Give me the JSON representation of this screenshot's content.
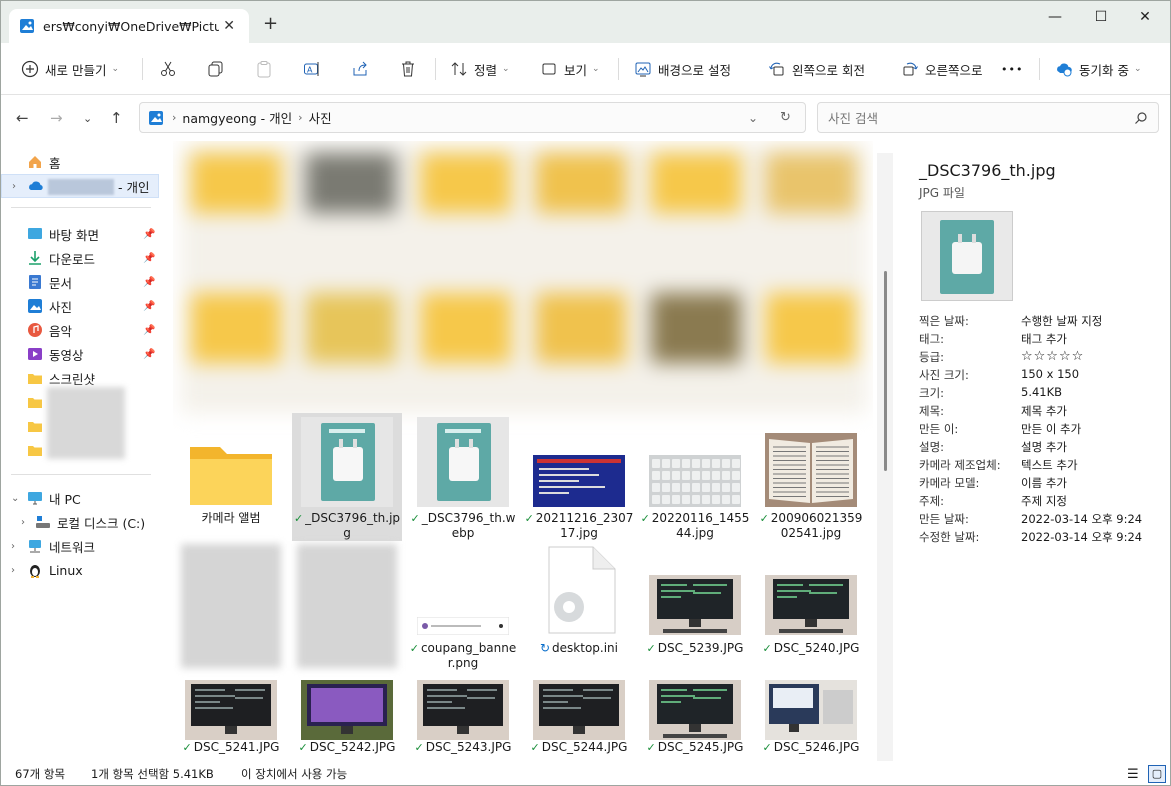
{
  "titlebar": {
    "tab_title": "ers₩conyi₩OneDrive₩Pictures",
    "close_tab": "✕",
    "new_tab": "+",
    "minimize": "—",
    "maximize": "☐",
    "close": "✕"
  },
  "toolbar": {
    "new": "새로 만들기",
    "sort": "정렬",
    "view": "보기",
    "set_background": "배경으로 설정",
    "rotate_left": "왼쪽으로 회전",
    "rotate_right": "오른쪽으로",
    "more": "•••",
    "sync": "동기화 중"
  },
  "address": {
    "path": [
      "namgyeong - 개인",
      "사진"
    ],
    "search_placeholder": "사진 검색"
  },
  "sidebar": {
    "home": "홈",
    "onedrive": "- 개인",
    "quick": [
      {
        "label": "바탕 화면",
        "icon": "desktop-icon",
        "pinned": true
      },
      {
        "label": "다운로드",
        "icon": "download-icon",
        "pinned": true
      },
      {
        "label": "문서",
        "icon": "document-icon",
        "pinned": true
      },
      {
        "label": "사진",
        "icon": "pictures-icon",
        "pinned": true
      },
      {
        "label": "음악",
        "icon": "music-icon",
        "pinned": true
      },
      {
        "label": "동영상",
        "icon": "video-icon",
        "pinned": true
      },
      {
        "label": "스크린샷",
        "icon": "folder-icon",
        "pinned": false
      }
    ],
    "pc": "내 PC",
    "drive": "로컬 디스크 (C:)",
    "network": "네트워크",
    "linux": "Linux"
  },
  "files": [
    {
      "name": "카메라 앨범",
      "kind": "folder",
      "synced": false
    },
    {
      "name": "_DSC3796_th.jpg",
      "kind": "product",
      "synced": true,
      "selected": true
    },
    {
      "name": "_DSC3796_th.webp",
      "kind": "product",
      "synced": true
    },
    {
      "name": "20211216_230717.jpg",
      "kind": "screen-blue",
      "synced": true
    },
    {
      "name": "20220116_145544.jpg",
      "kind": "keyboard",
      "synced": true
    },
    {
      "name": "20090602135902541.jpg",
      "kind": "book",
      "synced": true
    },
    {
      "name": "coupang_banner.png",
      "kind": "banner",
      "synced": true
    },
    {
      "name": "desktop.ini",
      "kind": "ini",
      "synced": false,
      "syncing": true
    },
    {
      "name": "DSC_5239.JPG",
      "kind": "monitor",
      "synced": true
    },
    {
      "name": "DSC_5240.JPG",
      "kind": "monitor",
      "synced": true
    },
    {
      "name": "DSC_5241.JPG",
      "kind": "monitor-dark",
      "synced": true
    },
    {
      "name": "DSC_5242.JPG",
      "kind": "monitor-purple",
      "synced": true
    },
    {
      "name": "DSC_5243.JPG",
      "kind": "monitor-dark",
      "synced": true
    },
    {
      "name": "DSC_5244.JPG",
      "kind": "monitor-dark",
      "synced": true
    },
    {
      "name": "DSC_5245.JPG",
      "kind": "monitor",
      "synced": true
    },
    {
      "name": "DSC_5246.JPG",
      "kind": "monitor-light",
      "synced": true
    }
  ],
  "details": {
    "title": "_DSC3796_th.jpg",
    "type": "JPG 파일",
    "props": [
      {
        "k": "찍은 날짜:",
        "v": "수행한 날짜 지정"
      },
      {
        "k": "태그:",
        "v": "태그 추가"
      },
      {
        "k": "등급:",
        "v": "☆☆☆☆☆"
      },
      {
        "k": "사진 크기:",
        "v": "150 x 150"
      },
      {
        "k": "크기:",
        "v": "5.41KB"
      },
      {
        "k": "제목:",
        "v": "제목 추가"
      },
      {
        "k": "만든 이:",
        "v": "만든 이 추가"
      },
      {
        "k": "설명:",
        "v": "설명 추가"
      },
      {
        "k": "카메라 제조업체:",
        "v": "텍스트 추가"
      },
      {
        "k": "카메라 모델:",
        "v": "이름 추가"
      },
      {
        "k": "주제:",
        "v": "주제 지정"
      },
      {
        "k": "만든 날짜:",
        "v": "2022-03-14 오후 9:24"
      },
      {
        "k": "수정한 날짜:",
        "v": "2022-03-14 오후 9:24"
      }
    ]
  },
  "status": {
    "count": "67개 항목",
    "selected": "1개 항목 선택함 5.41KB",
    "availability": "이 장치에서 사용 가능"
  }
}
